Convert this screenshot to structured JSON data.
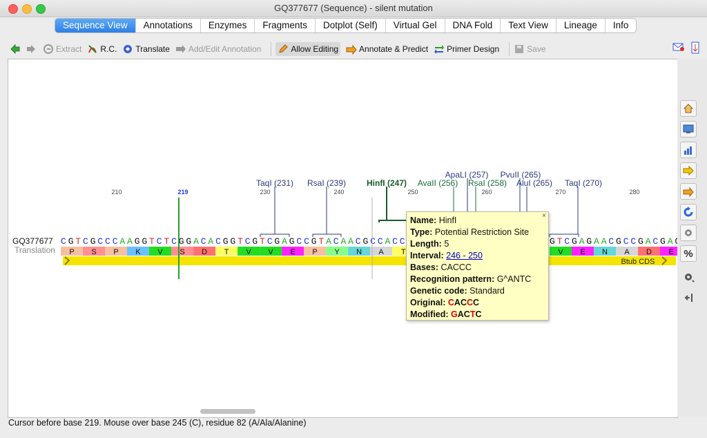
{
  "window": {
    "title": "GQ377677 (Sequence) - silent mutation"
  },
  "tabs": [
    "Sequence View",
    "Annotations",
    "Enzymes",
    "Fragments",
    "Dotplot (Self)",
    "Virtual Gel",
    "DNA Fold",
    "Text View",
    "Lineage",
    "Info"
  ],
  "toolbar": {
    "extract": "Extract",
    "rc": "R.C.",
    "translate": "Translate",
    "add_edit_annotation": "Add/Edit Annotation",
    "allow_editing": "Allow Editing",
    "annotate_predict": "Annotate & Predict",
    "primer_design": "Primer Design",
    "save": "Save"
  },
  "sequence": {
    "name": "GQ377677",
    "translation_label": "Translation",
    "ruler": [
      "210",
      "219",
      "230",
      "240",
      "250",
      "260",
      "270",
      "280"
    ],
    "cursor_position": "219",
    "bases_left": "CGTCGCCCAAGGTCTCGGACACGGTCGTCGAGCCGTACAACGCCACC",
    "bases_right": "GTCGAGAACGCCGACGAG",
    "amino_acids_left": [
      "P",
      "S",
      "P",
      "K",
      "V",
      "S",
      "D",
      "T",
      "V",
      "V",
      "E",
      "P",
      "Y",
      "N",
      "A",
      "T"
    ],
    "amino_acids_right": [
      "V",
      "E",
      "N",
      "A",
      "D",
      "E"
    ],
    "cds_label": "Btub CDS"
  },
  "enzymes": [
    "TaqI (231)",
    "RsaI (239)",
    "HinfI (247)",
    "AvaII (256)",
    "ApaLI (257)",
    "RsaI (258)",
    "PvuII (265)",
    "AluI (265)",
    "TaqI (270)"
  ],
  "tooltip": {
    "name_label": "Name:",
    "name": "HinfI",
    "type_label": "Type:",
    "type": "Potential Restriction Site",
    "length_label": "Length:",
    "length": "5",
    "interval_label": "Interval:",
    "interval": "246 - 250",
    "bases_label": "Bases:",
    "bases": "CACCC",
    "recognition_label": "Recognition pattern:",
    "recognition": "G^ANTC",
    "genetic_label": "Genetic code:",
    "genetic": "Standard",
    "original_label": "Original:",
    "modified_label": "Modified:",
    "close": "×"
  },
  "status": "Cursor before base 219. Mouse over base 245 (C), residue 82 (A/Ala/Alanine)",
  "colors": {
    "A": "#22aa22",
    "C": "#2233dd",
    "G": "#111111",
    "T": "#dd2222",
    "cds": "#f5e400",
    "accent": "#2d7fe5"
  }
}
